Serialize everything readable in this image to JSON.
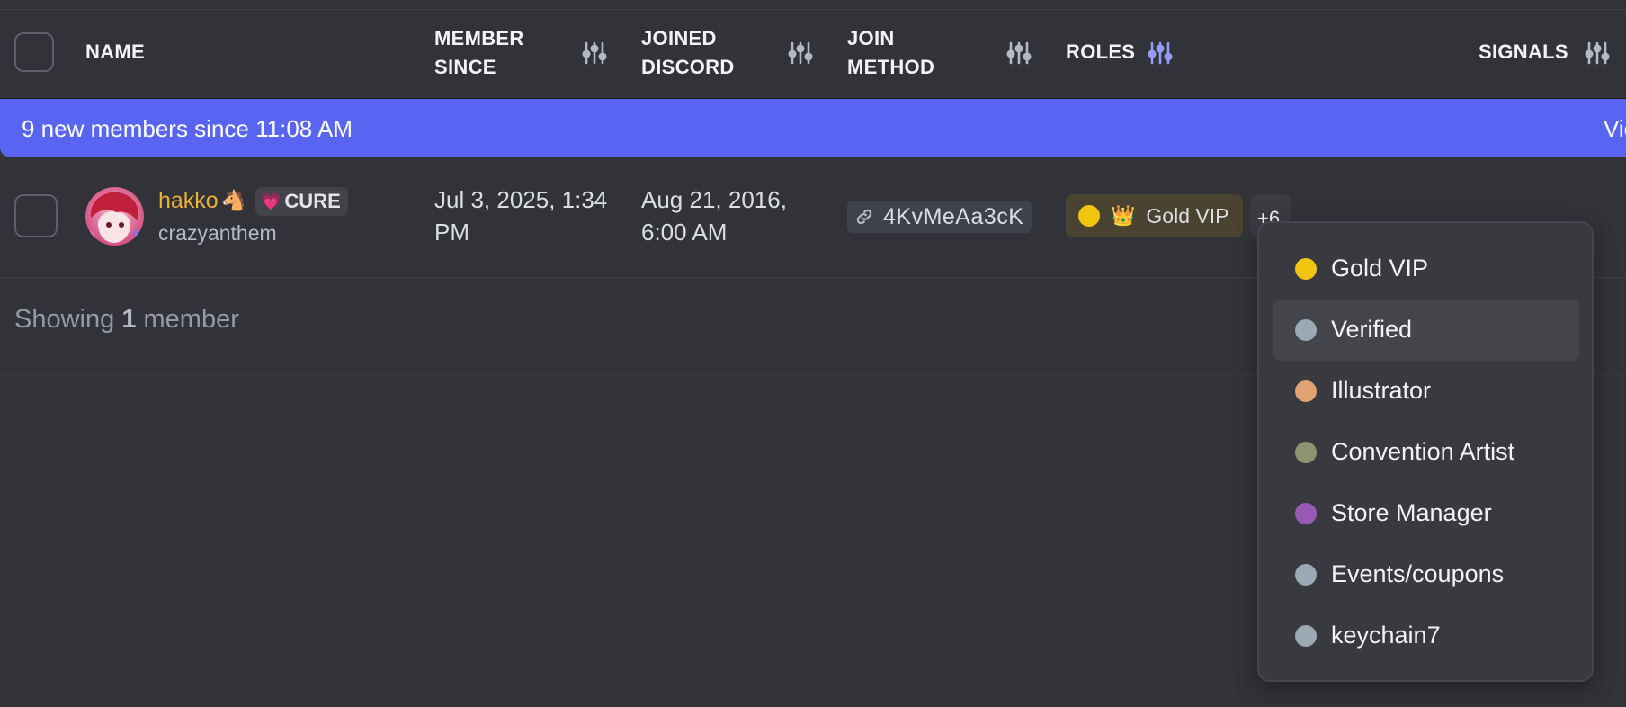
{
  "header": {
    "name": "NAME",
    "member_since_1": "MEMBER",
    "member_since_2": "SINCE",
    "joined_discord_1": "JOINED",
    "joined_discord_2": "DISCORD",
    "join_method_1": "JOIN",
    "join_method_2": "METHOD",
    "roles": "ROLES",
    "signals": "SIGNALS"
  },
  "banner": {
    "text": "9 new members since 11:08 AM",
    "link": "View"
  },
  "member": {
    "display_name": "hakko",
    "name_emoji": "🐴",
    "tag_emoji": "💗",
    "tag_label": "CURE",
    "username": "crazyanthem",
    "member_since_line1": "Jul 3, 2025, 1:34",
    "member_since_line2": "PM",
    "joined_discord_line1": "Aug 21, 2016,",
    "joined_discord_line2": "6:00 AM",
    "invite_code": "4KvMeAa3cK",
    "primary_role": "Gold VIP",
    "primary_role_emoji": "👑",
    "primary_role_color": "#f1c40f",
    "more_roles": "+6"
  },
  "footer": {
    "showing_prefix": "Showing",
    "showing_count": "1",
    "showing_suffix": "member"
  },
  "roles_popup": [
    {
      "label": "Gold VIP",
      "color": "#f1c40f"
    },
    {
      "label": "Verified",
      "color": "#99aab5"
    },
    {
      "label": "Illustrator",
      "color": "#e0a271"
    },
    {
      "label": "Convention Artist",
      "color": "#8e9471"
    },
    {
      "label": "Store Manager",
      "color": "#9b59b6"
    },
    {
      "label": "Events/coupons",
      "color": "#99aab5"
    },
    {
      "label": "keychain7",
      "color": "#99aab5"
    }
  ],
  "colors": {
    "accent": "#5865f2",
    "background": "#313338",
    "name_color": "#f0b232"
  }
}
